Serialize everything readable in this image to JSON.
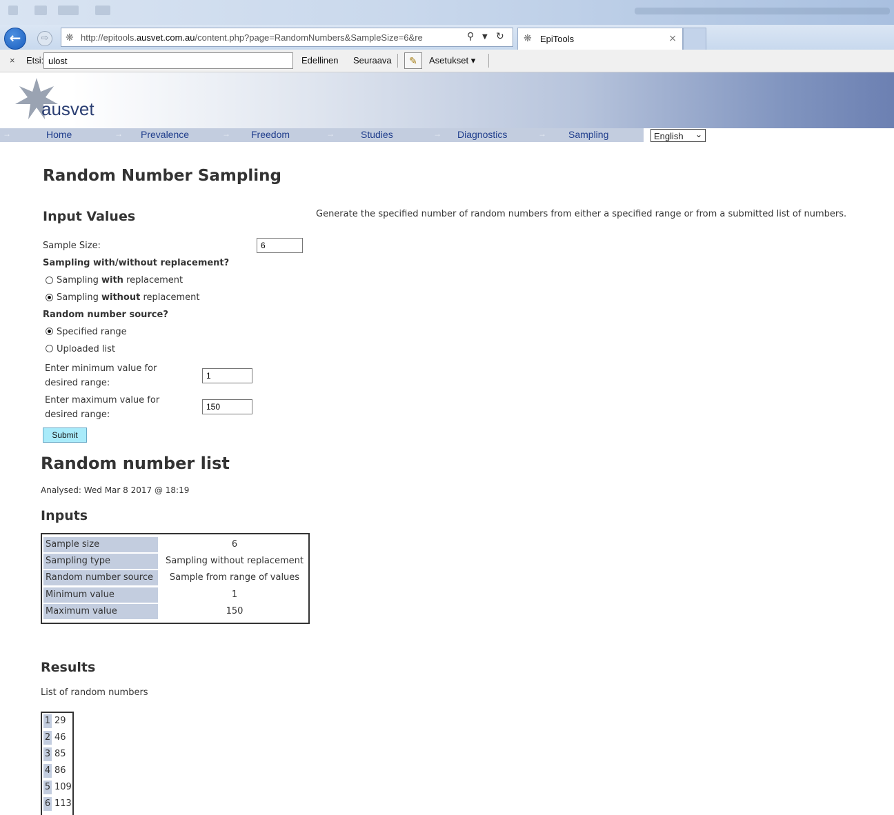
{
  "browser": {
    "url_prefix": "http://epitools.",
    "url_domain": "ausvet.com.au",
    "url_rest": "/content.php?page=RandomNumbers&SampleSize=6&re",
    "tab_title": "EpiTools",
    "search_icon": "magnifier-icon",
    "refresh_icon": "refresh-icon"
  },
  "findbar": {
    "close": "×",
    "label": "Etsi:",
    "query": "ulost",
    "previous": "Edellinen",
    "next": "Seuraava",
    "settings": "Asetukset ▾"
  },
  "header": {
    "logo_text": "ausvet"
  },
  "nav": {
    "items": [
      "Home",
      "Prevalence",
      "Freedom",
      "Studies",
      "Diagnostics",
      "Sampling"
    ],
    "language": "English"
  },
  "page": {
    "title": "Random Number Sampling",
    "input_heading": "Input Values",
    "description": "Generate the specified number of random numbers from either a specified range or from a submitted list of numbers."
  },
  "form": {
    "sample_size_label": "Sample Size:",
    "sample_size_value": "6",
    "replacement_question": "Sampling with/without replacement?",
    "with_replacement_pre": "Sampling ",
    "with_replacement_bold": "with",
    "with_replacement_post": " replacement",
    "without_replacement_pre": "Sampling ",
    "without_replacement_bold": "without",
    "without_replacement_post": " replacement",
    "source_question": "Random number source?",
    "specified_range": "Specified range",
    "uploaded_list": "Uploaded list",
    "min_label_1": "Enter minimum value for",
    "min_label_2": "desired range:",
    "min_value": "1",
    "max_label_1": "Enter maximum value for",
    "max_label_2": "desired range:",
    "max_value": "150",
    "submit": "Submit"
  },
  "results": {
    "heading": "Random number list",
    "analysed": "Analysed: Wed Mar 8 2017 @ 18:19",
    "inputs_heading": "Inputs",
    "inputs": [
      {
        "key": "Sample size",
        "value": "6"
      },
      {
        "key": "Sampling type",
        "value": "Sampling without replacement"
      },
      {
        "key": "Random number source",
        "value": "Sample from range of values"
      },
      {
        "key": "Minimum value",
        "value": "1"
      },
      {
        "key": "Maximum value",
        "value": "150"
      }
    ],
    "results_heading": "Results",
    "list_caption": "List of random numbers",
    "numbers": [
      {
        "index": "1",
        "value": "29"
      },
      {
        "index": "2",
        "value": "46"
      },
      {
        "index": "3",
        "value": "85"
      },
      {
        "index": "4",
        "value": "86"
      },
      {
        "index": "5",
        "value": "109"
      },
      {
        "index": "6",
        "value": "113"
      }
    ]
  }
}
